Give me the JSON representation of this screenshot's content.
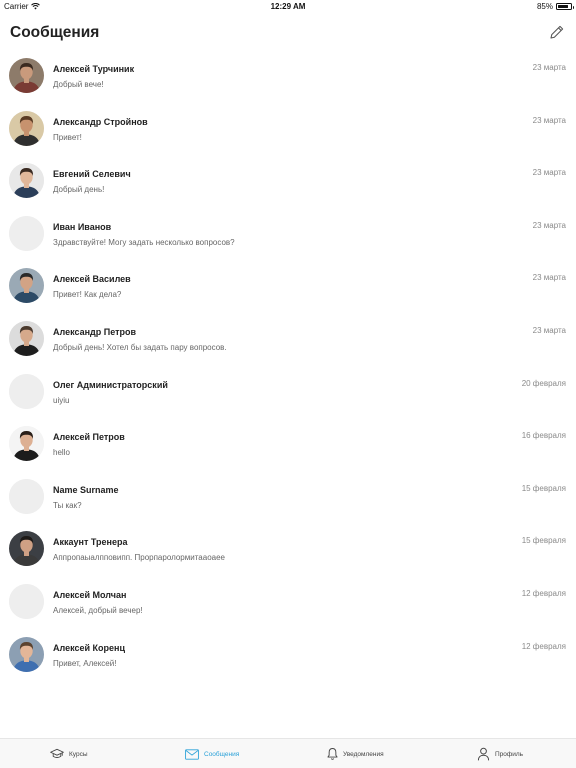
{
  "status_bar": {
    "carrier": "Carrier",
    "time": "12:29 AM",
    "battery": "85%",
    "battery_level": 0.85
  },
  "header": {
    "title": "Сообщения",
    "compose_icon": "pencil-icon"
  },
  "conversations": [
    {
      "name": "Алексей Турчиник",
      "preview": "Добрый вече!",
      "date": "23 марта",
      "avatar": "photo",
      "bg": "#8d7b6a",
      "skin": "#c99a7c",
      "hair": "#3a2a20",
      "shirt": "#7a3b34"
    },
    {
      "name": "Александр Стройнов",
      "preview": "Привет!",
      "date": "23 марта",
      "avatar": "photo",
      "bg": "#d9c9a6",
      "skin": "#c7926e",
      "hair": "#5a3b24",
      "shirt": "#2f2f2f"
    },
    {
      "name": "Евгений Селевич",
      "preview": "Добрый день!",
      "date": "23 марта",
      "avatar": "photo",
      "bg": "#e8e8e8",
      "skin": "#e0b79a",
      "hair": "#3b2b22",
      "shirt": "#2b3e59"
    },
    {
      "name": "Иван Иванов",
      "preview": "Здравствуйте! Могу задать несколько вопросов?",
      "date": "23 марта",
      "avatar": "placeholder"
    },
    {
      "name": "Алексей Василев",
      "preview": "Привет! Как дела?",
      "date": "23 марта",
      "avatar": "photo",
      "bg": "#9aa9b5",
      "skin": "#d2a385",
      "hair": "#2a2a2a",
      "shirt": "#2c4a66"
    },
    {
      "name": "Александр Петров",
      "preview": "Добрый день! Хотел бы задать пару вопросов.",
      "date": "23 марта",
      "avatar": "photo",
      "bg": "#dcdcdc",
      "skin": "#d6a98b",
      "hair": "#4b3a2e",
      "shirt": "#1e1e1e"
    },
    {
      "name": "Олег Администраторский",
      "preview": "uiyiu",
      "date": "20 февраля",
      "avatar": "placeholder"
    },
    {
      "name": "Алексей Петров",
      "preview": "hello",
      "date": "16 февраля",
      "avatar": "photo",
      "bg": "#f4f4f4",
      "skin": "#ddb093",
      "hair": "#2a1f19",
      "shirt": "#1c1c1c"
    },
    {
      "name": "Name Surname",
      "preview": "Ты как?",
      "date": "15 февраля",
      "avatar": "placeholder"
    },
    {
      "name": "Аккаунт Тренера",
      "preview": "Аппропаыалпповипп. Прорпаролормитааоаее",
      "date": "15 февраля",
      "avatar": "photo",
      "bg": "#3c3f44",
      "skin": "#cfa084",
      "hair": "#1e1a18",
      "shirt": "#3a3a3a"
    },
    {
      "name": "Алексей Молчан",
      "preview": "Алексей, добрый вечер!",
      "date": "12 февраля",
      "avatar": "placeholder"
    },
    {
      "name": "Алексей Коренц",
      "preview": "Привет, Алексей!",
      "date": "12 февраля",
      "avatar": "photo",
      "bg": "#8c9fb3",
      "skin": "#e3b698",
      "hair": "#5b4330",
      "shirt": "#3f6fb0"
    }
  ],
  "tabs": [
    {
      "label": "Курсы",
      "icon": "graduation-cap-icon",
      "active": false
    },
    {
      "label": "Сообщения",
      "icon": "envelope-icon",
      "active": true
    },
    {
      "label": "Уведомления",
      "icon": "bell-icon",
      "active": false
    },
    {
      "label": "Профиль",
      "icon": "user-icon",
      "active": false
    }
  ],
  "colors": {
    "accent": "#2aa1d8",
    "text": "#222222",
    "muted": "#666666",
    "date": "#8a8a8a",
    "placeholder_avatar": "#eeeeee"
  }
}
